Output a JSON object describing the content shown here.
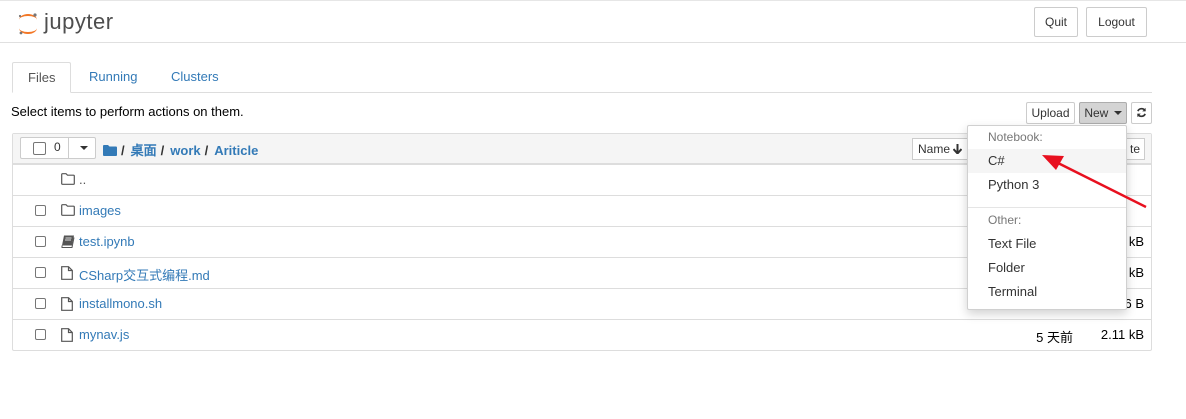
{
  "header": {
    "logo_text": "jupyter",
    "quit_label": "Quit",
    "logout_label": "Logout"
  },
  "tabs": [
    {
      "label": "Files",
      "active": true
    },
    {
      "label": "Running",
      "active": false
    },
    {
      "label": "Clusters",
      "active": false
    }
  ],
  "toolbar": {
    "hint": "Select items to perform actions on them.",
    "upload_label": "Upload",
    "new_label": "New"
  },
  "list_header": {
    "selected_count": "0",
    "breadcrumb": [
      "桌面",
      "work",
      "Ariticle"
    ],
    "name_sort_label": "Name",
    "right_col_label": "te"
  },
  "files": [
    {
      "name": "..",
      "type": "parent",
      "date": "",
      "size": ""
    },
    {
      "name": "images",
      "type": "folder",
      "date": "",
      "size": ""
    },
    {
      "name": "test.ipynb",
      "type": "notebook",
      "date": "",
      "size": "kB"
    },
    {
      "name": "CSharp交互式编程.md",
      "type": "file",
      "date": "",
      "size": "kB"
    },
    {
      "name": "installmono.sh",
      "type": "file",
      "date": "",
      "size": "6 B"
    },
    {
      "name": "mynav.js",
      "type": "file",
      "date": "5 天前",
      "size": "2.11 kB"
    }
  ],
  "new_menu": {
    "notebook_header": "Notebook:",
    "notebook_items": [
      "C#",
      "Python 3"
    ],
    "other_header": "Other:",
    "other_items": [
      "Text File",
      "Folder",
      "Terminal"
    ]
  },
  "colors": {
    "link": "#337ab7",
    "logo_orange": "#f37726",
    "annotation_arrow": "#e8101f"
  }
}
